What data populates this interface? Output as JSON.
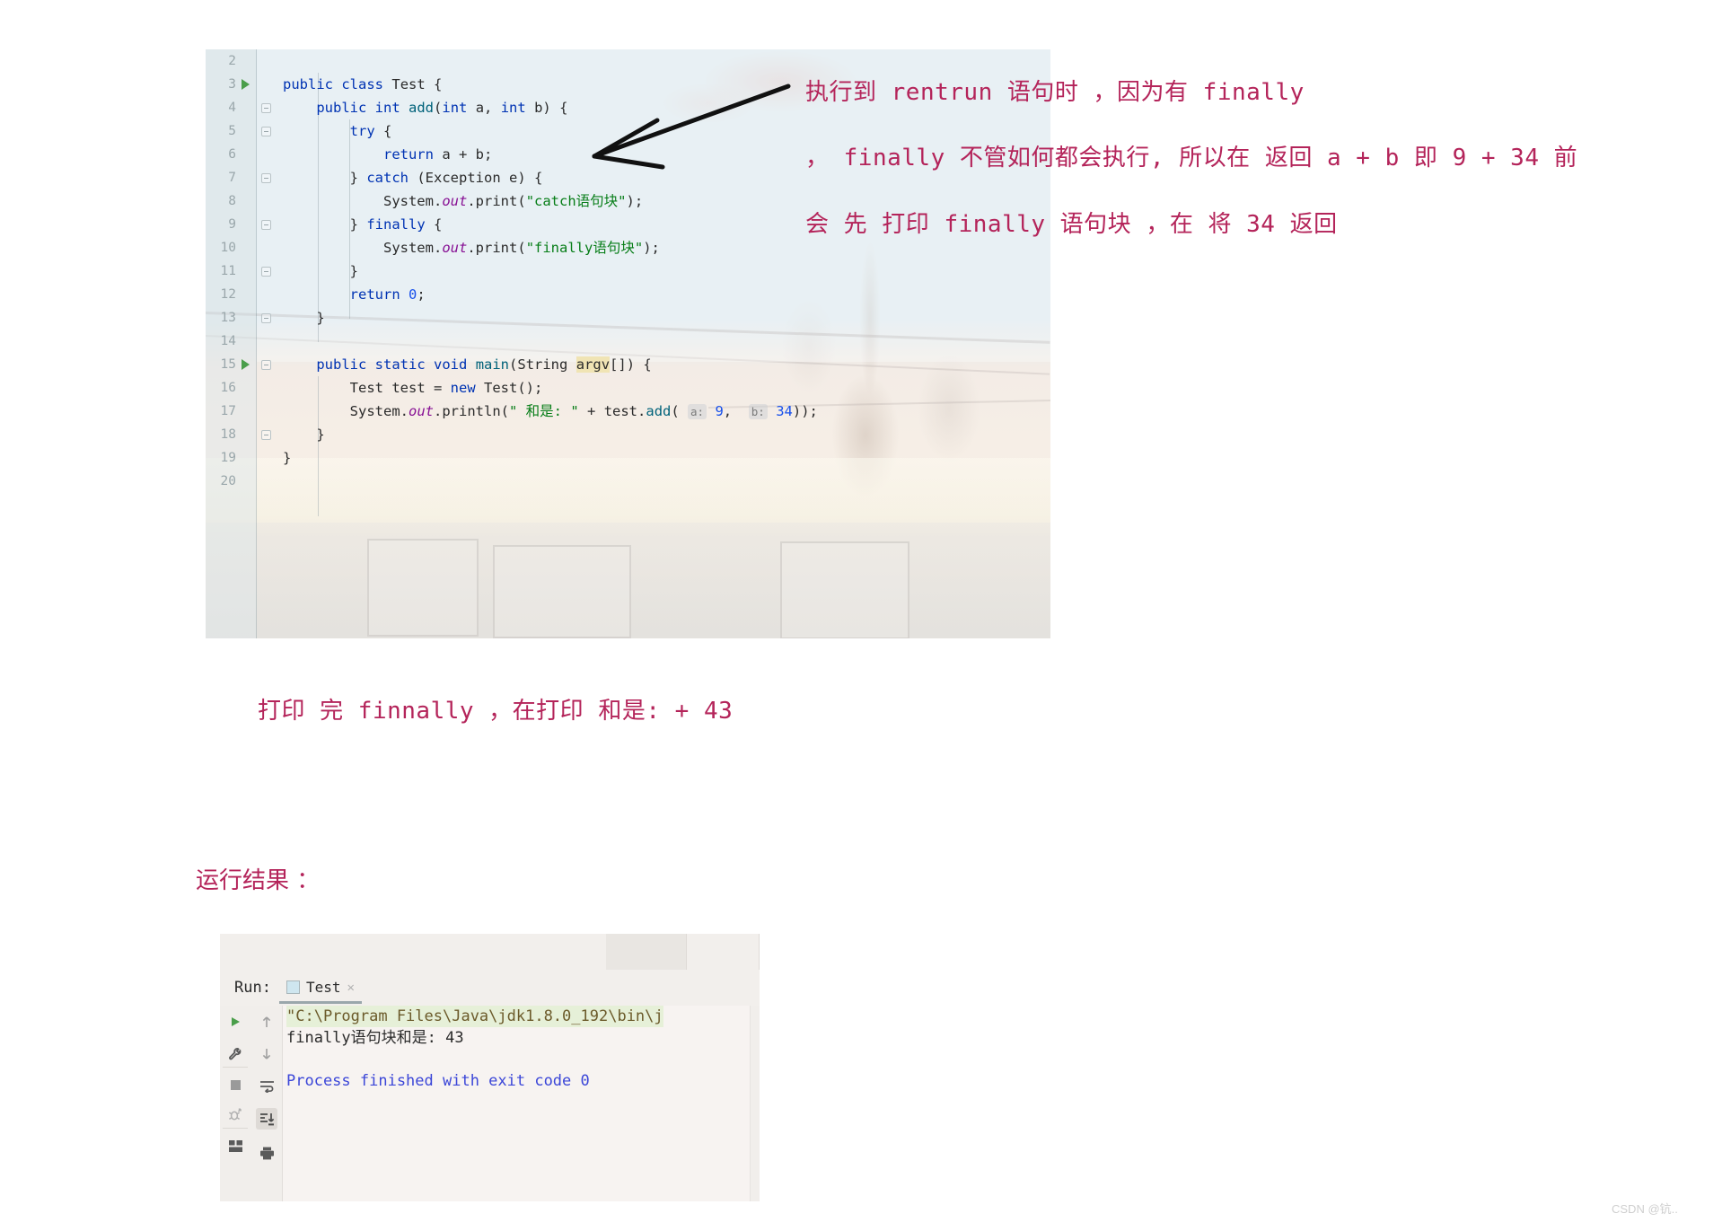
{
  "editor": {
    "lines": [
      {
        "num": "2",
        "code": "",
        "runmark": false,
        "fold": false
      },
      {
        "num": "3",
        "code": "public class Test {",
        "runmark": true,
        "fold": false
      },
      {
        "num": "4",
        "code": "    public int add(int a, int b) {",
        "runmark": false,
        "fold": true
      },
      {
        "num": "5",
        "code": "        try {",
        "runmark": false,
        "fold": true
      },
      {
        "num": "6",
        "code": "            return a + b;",
        "runmark": false,
        "fold": false
      },
      {
        "num": "7",
        "code": "        } catch (Exception e) {",
        "runmark": false,
        "fold": true
      },
      {
        "num": "8",
        "code": "            System.out.print(\"catch语句块\");",
        "runmark": false,
        "fold": false
      },
      {
        "num": "9",
        "code": "        } finally {",
        "runmark": false,
        "fold": true
      },
      {
        "num": "10",
        "code": "            System.out.print(\"finally语句块\");",
        "runmark": false,
        "fold": false
      },
      {
        "num": "11",
        "code": "        }",
        "runmark": false,
        "fold": true
      },
      {
        "num": "12",
        "code": "        return 0;",
        "runmark": false,
        "fold": false
      },
      {
        "num": "13",
        "code": "    }",
        "runmark": false,
        "fold": true
      },
      {
        "num": "14",
        "code": "",
        "runmark": false,
        "fold": false
      },
      {
        "num": "15",
        "code": "    public static void main(String argv[]) {",
        "runmark": true,
        "fold": true
      },
      {
        "num": "16",
        "code": "        Test test = new Test();",
        "runmark": false,
        "fold": false
      },
      {
        "num": "17",
        "code": "        System.out.println(\" 和是: \" + test.add( a: 9,  b: 34));",
        "runmark": false,
        "fold": false
      },
      {
        "num": "18",
        "code": "    }",
        "runmark": false,
        "fold": true
      },
      {
        "num": "19",
        "code": "}",
        "runmark": false,
        "fold": false
      },
      {
        "num": "20",
        "code": "",
        "runmark": false,
        "fold": false
      }
    ],
    "param_hints": {
      "a": "a:",
      "a_value": "9",
      "b": "b:",
      "b_value": "34"
    },
    "highlighted_token": "argv"
  },
  "annotations": {
    "arrow_label": "arrow pointing to return a + b",
    "line_1": "执行到 rentrun 语句时 ，因为有 finally",
    "line_2": "， finally 不管如何都会执行, 所以在 返回 a + b 即 9 + 34 前",
    "line_3": "会 先 打印 finally 语句块 ，在 将 34 返回",
    "below_code": "打印 完 finnally ，在打印 和是: + 43"
  },
  "section": {
    "heading": "运行结果 ："
  },
  "console": {
    "run_label": "Run:",
    "tab_name": "Test",
    "tab_close": "✕",
    "output": [
      {
        "text": "\"C:\\Program Files\\Java\\jdk1.8.0_192\\bin\\j",
        "style": "cmd"
      },
      {
        "text": "finally语句块和是: 43",
        "style": "text"
      },
      {
        "text": "",
        "style": "text"
      },
      {
        "text": "Process finished with exit code 0",
        "style": "end"
      }
    ],
    "toolbar_left": [
      "run-icon",
      "wrench-icon",
      "stop-icon",
      "debug-icon",
      "layout-icon"
    ],
    "toolbar_right": [
      "scroll-up-icon",
      "scroll-down-icon",
      "soft-wrap-icon",
      "scroll-to-end-icon",
      "print-icon"
    ]
  },
  "watermark": "CSDN @钪..",
  "colors": {
    "annotation_red": "#b4245a",
    "keyword_blue": "#0033b3",
    "string_green": "#067d17",
    "field_purple": "#871094",
    "number_blue": "#1750eb",
    "method_teal": "#00627a"
  }
}
